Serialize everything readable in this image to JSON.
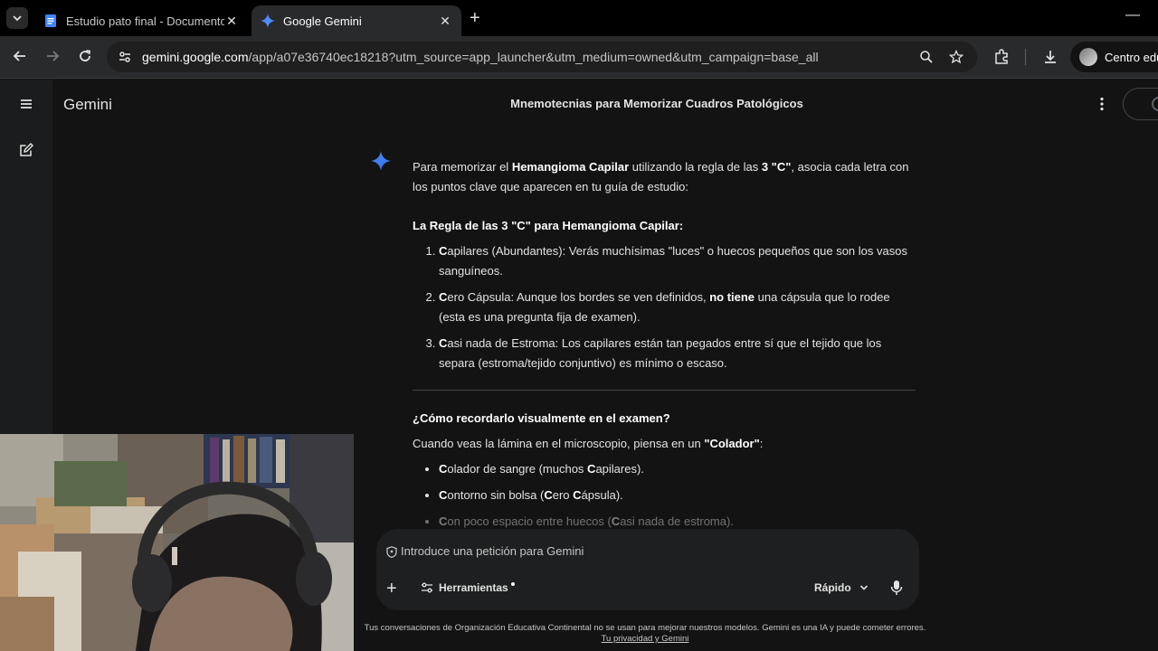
{
  "browser": {
    "tabs": [
      {
        "label": "Estudio pato final - Documento",
        "active": false
      },
      {
        "label": "Google Gemini",
        "active": true
      }
    ],
    "url_host": "gemini.google.com",
    "url_path": "/app/a07e36740ec18218?utm_source=app_launcher&utm_medium=owned&utm_campaign=base_all",
    "profile_label": "Centro educ"
  },
  "app": {
    "brand": "Gemini",
    "chat_title": "Mnemotecnias para Memorizar Cuadros Patológicos"
  },
  "response": {
    "intro_1": "Para memorizar el ",
    "intro_b1": "Hemangioma Capilar",
    "intro_2": " utilizando la regla de las ",
    "intro_b2": "3 \"C\"",
    "intro_3": ", asocia cada letra con los puntos clave que aparecen en tu guía de estudio:",
    "heading_rule": "La Regla de las 3 \"C\" para Hemangioma Capilar:",
    "rule_items": [
      {
        "letter": "C",
        "text": "apilares (Abundantes): Verás muchísimas \"luces\" o huecos pequeños que son los vasos sanguíneos."
      },
      {
        "letter": "C",
        "text_a": "ero Cápsula: Aunque los bordes se ven definidos, ",
        "bold": "no tiene",
        "text_b": " una cápsula que lo rodee (esta es una pregunta fija de examen)."
      },
      {
        "letter": "C",
        "text": "asi nada de Estroma: Los capilares están tan pegados entre sí que el tejido que los separa (estroma/tejido conjuntivo) es mínimo o escaso."
      }
    ],
    "heading_visual": "¿Cómo recordarlo visualmente en el examen?",
    "visual_intro_a": "Cuando veas la lámina en el microscopio, piensa en un ",
    "visual_intro_b": "\"Colador\"",
    "visual_intro_c": ":",
    "bullets": [
      {
        "c1": "C",
        "t1": "olador de sangre (muchos ",
        "c2": "C",
        "t2": "apilares)."
      },
      {
        "c1": "C",
        "t1": "ontorno sin bolsa (",
        "c2": "C",
        "t2": "ero ",
        "c3": "C",
        "t3": "ápsula)."
      },
      {
        "c1": "C",
        "t1": "on poco espacio entre huecos (",
        "c2": "C",
        "t2": "asi nada de estroma)."
      }
    ]
  },
  "input": {
    "placeholder": "Introduce una petición para Gemini",
    "tools_label": "Herramientas",
    "mode_label": "Rápido"
  },
  "footer": {
    "disclaimer": "Tus conversaciones de Organización Educativa Continental no se usan para mejorar nuestros modelos. Gemini es una IA y puede cometer errores.",
    "privacy_link": "Tu privacidad y Gemini"
  },
  "colors": {
    "background": "#131314",
    "sidebar": "#1b1c1d",
    "accent_blue": "#4285f4"
  }
}
